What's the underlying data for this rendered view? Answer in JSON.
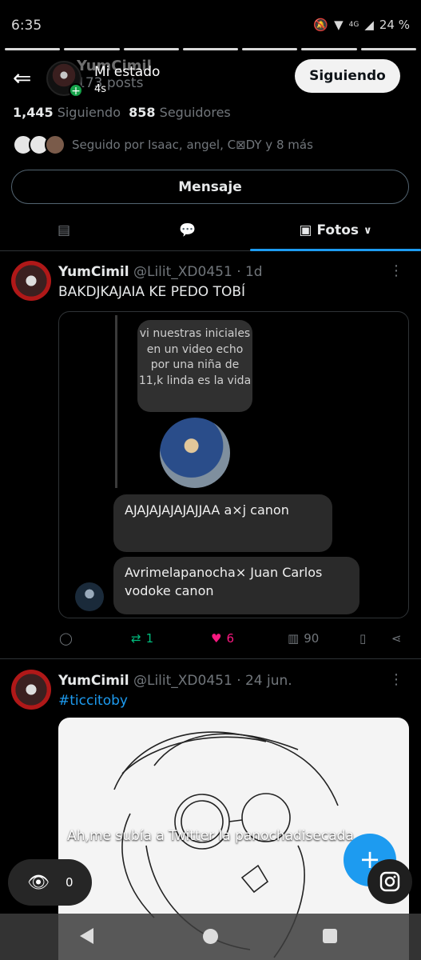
{
  "status_bar": {
    "time": "6:35",
    "battery": "24 %",
    "network": "4G"
  },
  "story": {
    "title": "Mi estado",
    "age": "4s",
    "views": "0",
    "caption": "Ah,me subía a Twitter la panochadisecada"
  },
  "profile": {
    "name_ghost": "YumCimil",
    "posts_ghost": "173 posts",
    "follow_button": "Siguiendo",
    "following_count": "1,445",
    "following_label": "Siguiendo",
    "followers_count": "858",
    "followers_label": "Seguidores",
    "followed_by": "Seguido por Isaac, angel, C⊠DY y 8 más",
    "message_button": "Mensaje"
  },
  "tabs": {
    "active_label": "Fotos"
  },
  "tweets": [
    {
      "name": "YumCimil",
      "handle": "@Lilit_XD0451",
      "time": "· 1d",
      "text": "BAKDJKAJAIA KE PEDO TOBÍ",
      "media": {
        "bubble_text": "vi nuestras iniciales en un video echo por una niña de 11,k linda es la vida",
        "chat_1": "AJAJAJAJAJAJJAA a×j canon",
        "chat_2": "Avrimelapanocha× Juan Carlos vodoke  canon"
      },
      "stats": {
        "retweets": "1",
        "likes": "6",
        "views": "90"
      }
    },
    {
      "name": "YumCimil",
      "handle": "@Lilit_XD0451",
      "time": "· 24 jun.",
      "text": "#ticcitoby"
    }
  ],
  "colors": {
    "accent": "#1d9bf0",
    "retweet": "#00ba7c",
    "like": "#f91880"
  }
}
